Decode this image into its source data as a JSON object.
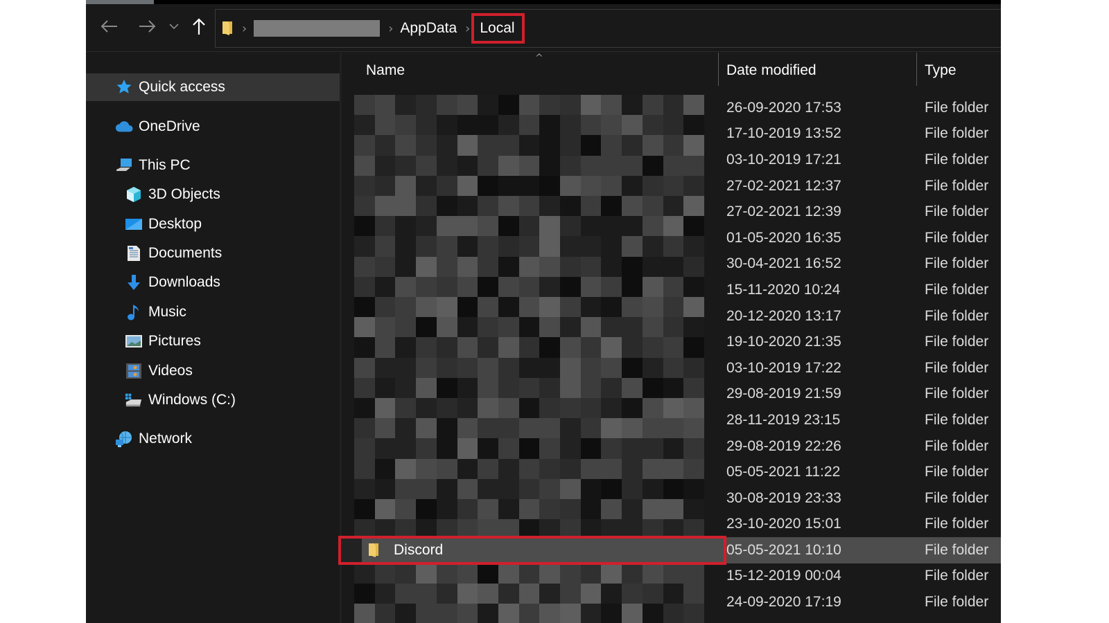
{
  "window": {
    "navigation": {
      "back_icon": "arrow-left-icon",
      "forward_icon": "arrow-right-icon",
      "recent_icon": "chevron-down-icon",
      "up_icon": "arrow-up-icon"
    },
    "address_bar": {
      "folder_icon": "folder-icon",
      "breadcrumbs": [
        {
          "label": "",
          "redacted": true
        },
        {
          "label": "AppData",
          "redacted": false
        },
        {
          "label": "Local",
          "redacted": false,
          "highlighted": true
        }
      ],
      "separator": "›"
    }
  },
  "sidebar": {
    "items": [
      {
        "label": "Quick access",
        "icon": "star-icon",
        "level": 1,
        "selected": true
      },
      {
        "label": "OneDrive",
        "icon": "cloud-icon",
        "level": 1
      },
      {
        "label": "This PC",
        "icon": "computer-icon",
        "level": 1
      },
      {
        "label": "3D Objects",
        "icon": "cube-icon",
        "level": 2
      },
      {
        "label": "Desktop",
        "icon": "desktop-icon",
        "level": 2
      },
      {
        "label": "Documents",
        "icon": "document-icon",
        "level": 2
      },
      {
        "label": "Downloads",
        "icon": "download-icon",
        "level": 2
      },
      {
        "label": "Music",
        "icon": "music-note-icon",
        "level": 2
      },
      {
        "label": "Pictures",
        "icon": "picture-icon",
        "level": 2
      },
      {
        "label": "Videos",
        "icon": "video-icon",
        "level": 2
      },
      {
        "label": "Windows (C:)",
        "icon": "drive-icon",
        "level": 2
      },
      {
        "label": "Network",
        "icon": "network-icon",
        "level": 1
      }
    ]
  },
  "file_list": {
    "columns": {
      "name": "Name",
      "date": "Date modified",
      "type": "Type"
    },
    "sort_indicator": "^",
    "rows": [
      {
        "name": "",
        "redacted": true,
        "date": "26-09-2020 17:53",
        "type": "File folder"
      },
      {
        "name": "",
        "redacted": true,
        "date": "17-10-2019 13:52",
        "type": "File folder"
      },
      {
        "name": "",
        "redacted": true,
        "date": "03-10-2019 17:21",
        "type": "File folder"
      },
      {
        "name": "",
        "redacted": true,
        "date": "27-02-2021 12:37",
        "type": "File folder"
      },
      {
        "name": "",
        "redacted": true,
        "date": "27-02-2021 12:39",
        "type": "File folder"
      },
      {
        "name": "",
        "redacted": true,
        "date": "01-05-2020 16:35",
        "type": "File folder"
      },
      {
        "name": "",
        "redacted": true,
        "date": "30-04-2021 16:52",
        "type": "File folder"
      },
      {
        "name": "",
        "redacted": true,
        "date": "15-11-2020 10:24",
        "type": "File folder"
      },
      {
        "name": "",
        "redacted": true,
        "date": "20-12-2020 13:17",
        "type": "File folder"
      },
      {
        "name": "",
        "redacted": true,
        "date": "19-10-2020 21:35",
        "type": "File folder"
      },
      {
        "name": "",
        "redacted": true,
        "date": "03-10-2019 17:22",
        "type": "File folder"
      },
      {
        "name": "",
        "redacted": true,
        "date": "29-08-2019 21:59",
        "type": "File folder"
      },
      {
        "name": "",
        "redacted": true,
        "date": "28-11-2019 23:15",
        "type": "File folder"
      },
      {
        "name": "",
        "redacted": true,
        "date": "29-08-2019 22:26",
        "type": "File folder"
      },
      {
        "name": "",
        "redacted": true,
        "date": "05-05-2021 11:22",
        "type": "File folder"
      },
      {
        "name": "",
        "redacted": true,
        "date": "30-08-2019 23:33",
        "type": "File folder"
      },
      {
        "name": "",
        "redacted": true,
        "date": "23-10-2020 15:01",
        "type": "File folder"
      },
      {
        "name": "Discord",
        "redacted": false,
        "selected": true,
        "highlighted": true,
        "date": "05-05-2021 10:10",
        "type": "File folder"
      },
      {
        "name": "",
        "redacted": true,
        "date": "15-12-2019 00:04",
        "type": "File folder"
      },
      {
        "name": "",
        "redacted": true,
        "date": "24-09-2020 17:19",
        "type": "File folder"
      }
    ]
  },
  "colors": {
    "background": "#191919",
    "selected_row": "#4d4d4d",
    "highlight_outline": "#d0202c",
    "folder_yellow": "#f3cf6b",
    "icon_blue": "#2ea3f2"
  }
}
